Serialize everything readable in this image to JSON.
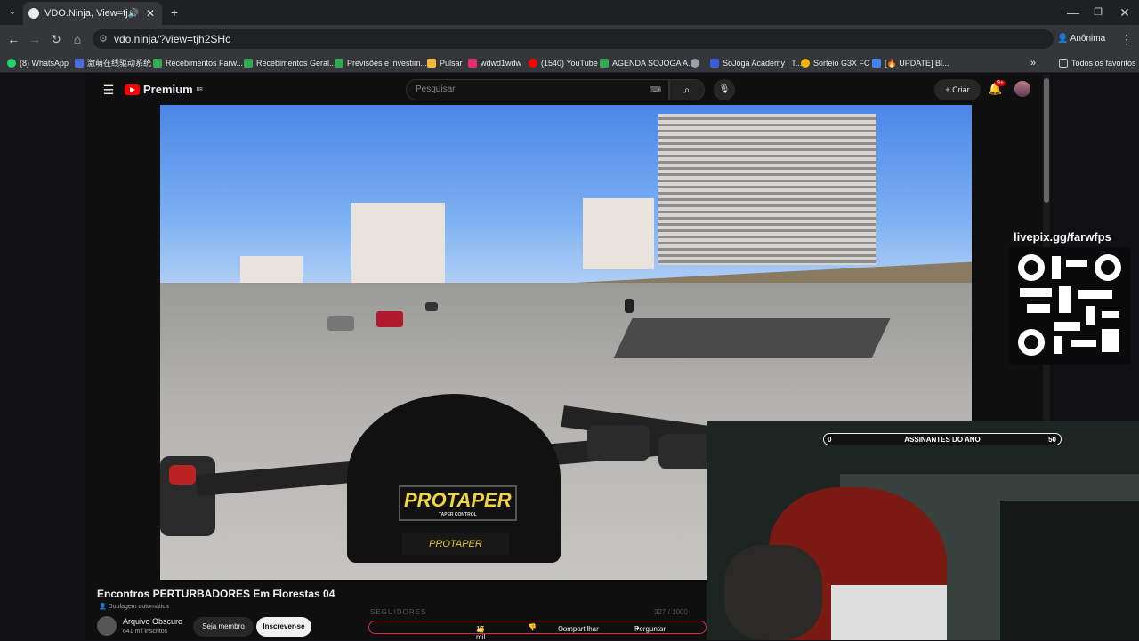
{
  "browser": {
    "tab_title": "VDO.Ninja, View=tjh2SHc",
    "new_tab": "+",
    "url": "vdo.ninja/?view=tjh2SHc",
    "profile_label": "Anônima",
    "all_bookmarks": "Todos os favoritos",
    "bookmarks": [
      {
        "label": "(8) WhatsApp",
        "color": "#25d366"
      },
      {
        "label": "激萌在线驱动系统",
        "color": "#4a6ee0"
      },
      {
        "label": "Recebimentos Farw...",
        "color": "#34a853"
      },
      {
        "label": "Recebimentos Geral...",
        "color": "#34a853"
      },
      {
        "label": "Previsões e investim...",
        "color": "#34a853"
      },
      {
        "label": "Pulsar",
        "color": "#f6b73c"
      },
      {
        "label": "wdwd1wdw",
        "color": "#e1306c"
      },
      {
        "label": "(1540) YouTube",
        "color": "#ff0000"
      },
      {
        "label": "AGENDA SOJOGA A...",
        "color": "#34a853"
      },
      {
        "label": "SoJoga Academy | T...",
        "color": "#3b5cd9"
      },
      {
        "label": "Sorteio G3X FC",
        "color": "#f4b400"
      },
      {
        "label": "[🔥 UPDATE] Bl...",
        "color": "#4285f4"
      }
    ]
  },
  "youtube": {
    "brand": "Premium",
    "brand_region": "BR",
    "search_placeholder": "Pesquisar",
    "create_label": "Criar",
    "notification_count": "9+",
    "video_title": "Encontros PERTURBADORES Em Florestas 04",
    "dub_label": "Dublagem automática",
    "channel_name": "Arquivo Obscuro",
    "channel_subs": "641 mil inscritos",
    "join_label": "Seja membro",
    "subscribe_label": "Inscrever-se",
    "likes": "17 mil",
    "share_label": "Compartilhar",
    "ask_label": "Perguntar"
  },
  "video": {
    "sticker_text": "PROTAPER",
    "sticker_sub": "TAPER CONTROL",
    "clamp_text": "PROTAPER"
  },
  "overlay": {
    "livepix_url": "livepix.gg/farwfps",
    "followers_label": "SEGUIDORES",
    "followers_count": "327 / 1000",
    "sub_goal_label": "ASSINANTES DO ANO",
    "sub_goal_current": "0",
    "sub_goal_target": "50"
  }
}
